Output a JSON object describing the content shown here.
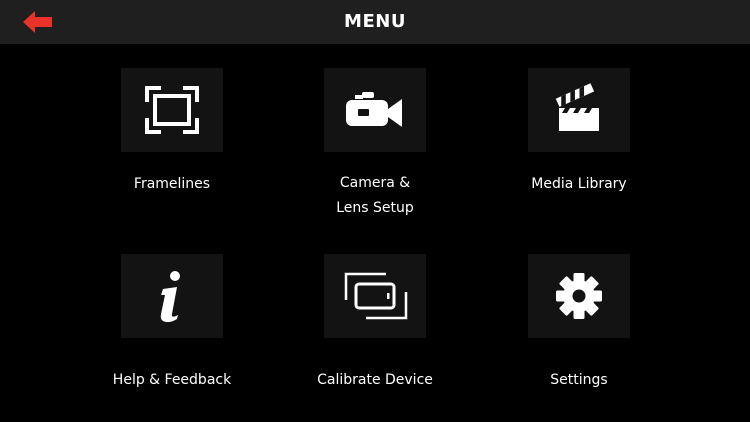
{
  "header": {
    "title": "MENU",
    "back_icon": "back-arrow-icon"
  },
  "colors": {
    "accent": "#e8322a",
    "header_bg": "#1f1f1f",
    "tile_bg": "#131313",
    "background": "#000000",
    "text": "#ffffff"
  },
  "menu": {
    "items": [
      {
        "id": "framelines",
        "lines": [
          "Framelines"
        ],
        "icon": "frame-icon"
      },
      {
        "id": "camera-lens-setup",
        "lines": [
          "Camera &",
          "Lens Setup"
        ],
        "icon": "video-camera-icon"
      },
      {
        "id": "media-library",
        "lines": [
          "Media Library"
        ],
        "icon": "clapperboard-icon"
      },
      {
        "id": "help-feedback",
        "lines": [
          "Help & Feedback"
        ],
        "icon": "info-icon"
      },
      {
        "id": "calibrate-device",
        "lines": [
          "Calibrate Device"
        ],
        "icon": "calibrate-device-icon"
      },
      {
        "id": "settings",
        "lines": [
          "Settings"
        ],
        "icon": "gear-icon"
      }
    ]
  }
}
